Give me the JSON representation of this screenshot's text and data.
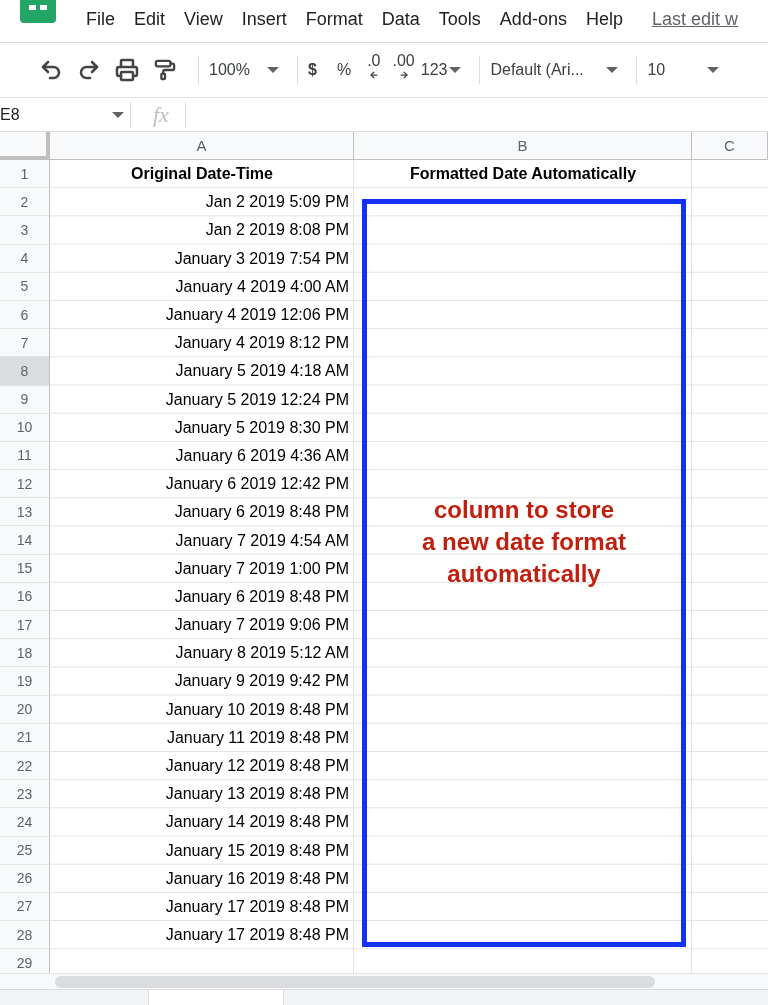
{
  "menu": {
    "items": [
      "File",
      "Edit",
      "View",
      "Insert",
      "Format",
      "Data",
      "Tools",
      "Add-ons",
      "Help"
    ],
    "last_edit": "Last edit w"
  },
  "toolbar": {
    "zoom": "100%",
    "currency": "$",
    "percent": "%",
    "decrease_decimals": ".0",
    "increase_decimals": ".00",
    "number_format": "123",
    "font": "Default (Ari...",
    "font_size": "10"
  },
  "formula_bar": {
    "name_box": "E8",
    "fx": "fx"
  },
  "columns": [
    "A",
    "B",
    "C"
  ],
  "rows": [
    {
      "number": "1",
      "a": "Original Date-Time",
      "b": "Formatted Date Automatically",
      "header": true,
      "selected": false
    },
    {
      "number": "2",
      "a": "Jan 2 2019 5:09 PM",
      "selected": false
    },
    {
      "number": "3",
      "a": "Jan 2 2019 8:08 PM",
      "selected": false
    },
    {
      "number": "4",
      "a": "January 3 2019 7:54 PM",
      "selected": false
    },
    {
      "number": "5",
      "a": "January 4 2019 4:00 AM",
      "selected": false
    },
    {
      "number": "6",
      "a": "January 4 2019 12:06 PM",
      "selected": false
    },
    {
      "number": "7",
      "a": "January 4 2019 8:12 PM",
      "selected": false
    },
    {
      "number": "8",
      "a": "January 5 2019 4:18 AM",
      "selected": true
    },
    {
      "number": "9",
      "a": "January 5 2019 12:24 PM",
      "selected": false
    },
    {
      "number": "10",
      "a": "January 5 2019 8:30 PM",
      "selected": false
    },
    {
      "number": "11",
      "a": "January 6 2019 4:36 AM",
      "selected": false
    },
    {
      "number": "12",
      "a": "January 6 2019 12:42 PM",
      "selected": false
    },
    {
      "number": "13",
      "a": "January 6 2019 8:48 PM",
      "selected": false
    },
    {
      "number": "14",
      "a": "January 7 2019 4:54 AM",
      "selected": false
    },
    {
      "number": "15",
      "a": "January 7 2019 1:00 PM",
      "selected": false
    },
    {
      "number": "16",
      "a": "January 6 2019 8:48 PM",
      "selected": false
    },
    {
      "number": "17",
      "a": "January 7 2019 9:06 PM",
      "selected": false
    },
    {
      "number": "18",
      "a": "January 8 2019 5:12 AM",
      "selected": false
    },
    {
      "number": "19",
      "a": "January 9 2019 9:42 PM",
      "selected": false
    },
    {
      "number": "20",
      "a": "January 10 2019 8:48 PM",
      "selected": false
    },
    {
      "number": "21",
      "a": "January 11 2019 8:48 PM",
      "selected": false
    },
    {
      "number": "22",
      "a": "January 12 2019 8:48 PM",
      "selected": false
    },
    {
      "number": "23",
      "a": "January 13 2019 8:48 PM",
      "selected": false
    },
    {
      "number": "24",
      "a": "January 14 2019 8:48 PM",
      "selected": false
    },
    {
      "number": "25",
      "a": "January 15 2019 8:48 PM",
      "selected": false
    },
    {
      "number": "26",
      "a": "January 16 2019 8:48 PM",
      "selected": false
    },
    {
      "number": "27",
      "a": "January 17 2019 8:48 PM",
      "selected": false
    },
    {
      "number": "28",
      "a": "January 17 2019 8:48 PM",
      "selected": false
    },
    {
      "number": "29",
      "selected": false
    }
  ],
  "annotation": {
    "lines": [
      "column to store",
      "a new date format",
      "automatically"
    ]
  }
}
